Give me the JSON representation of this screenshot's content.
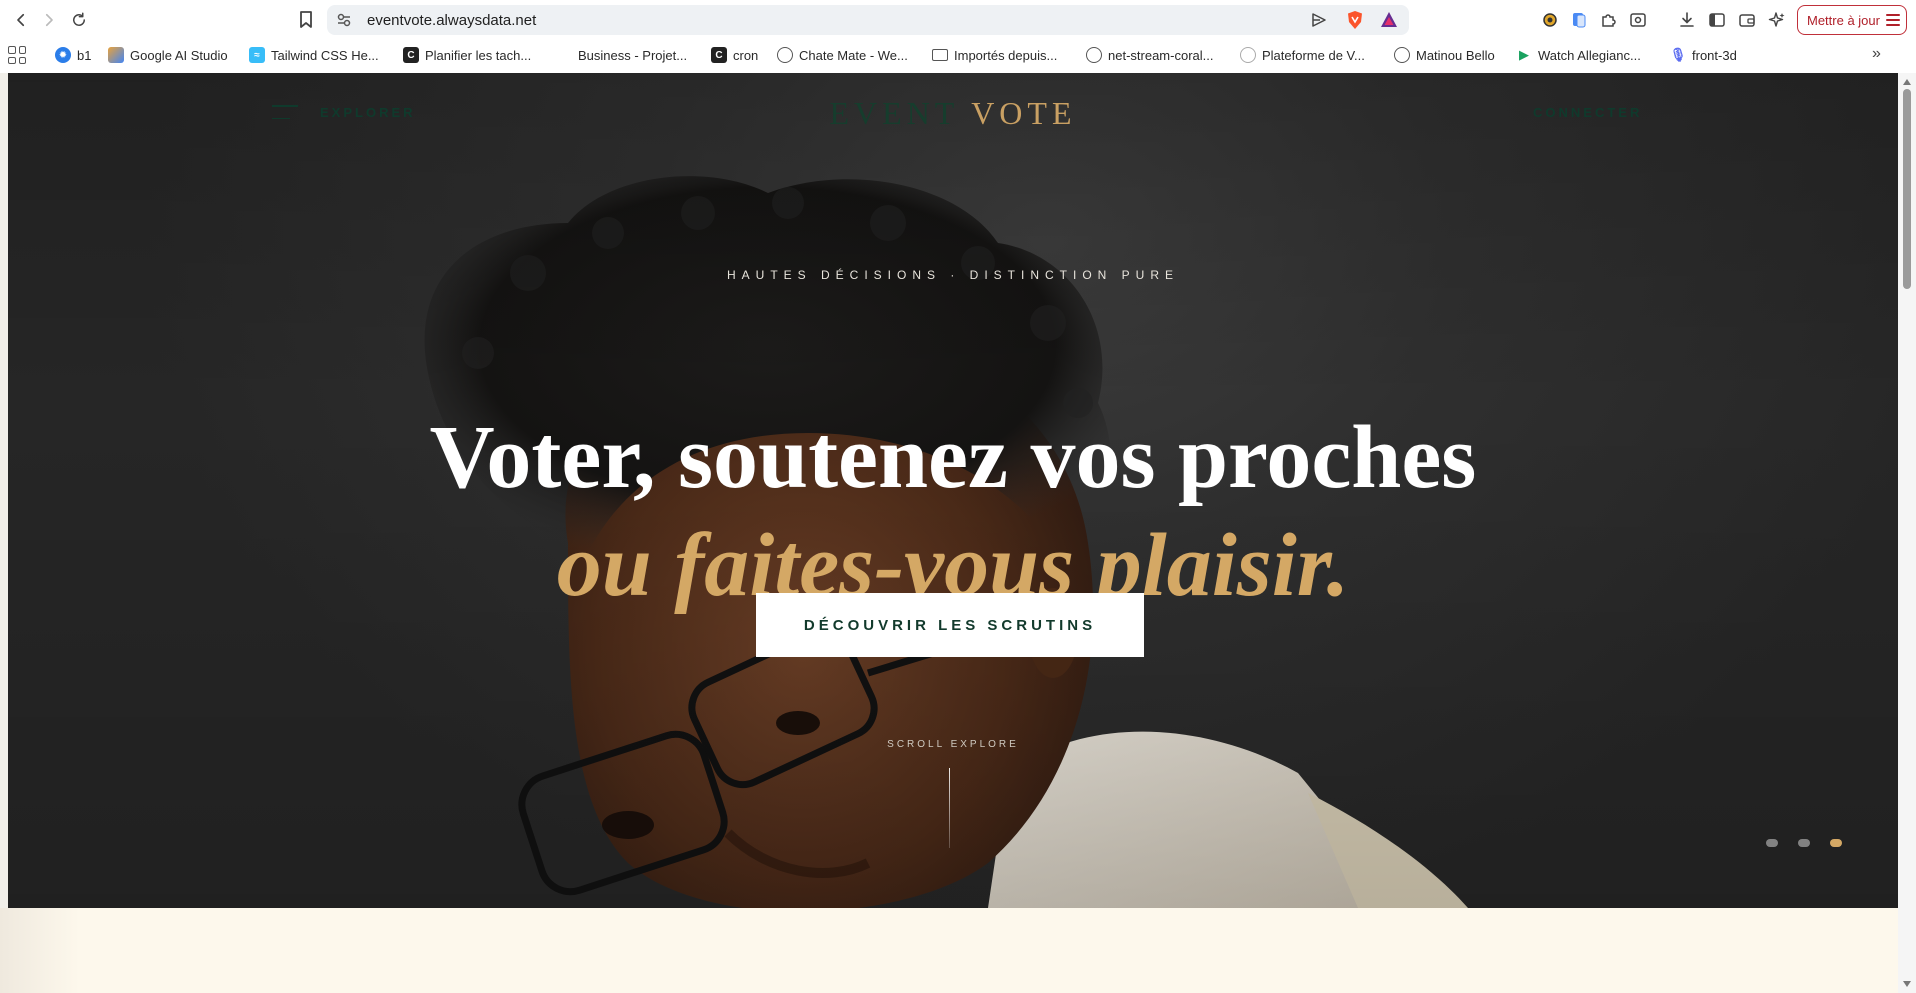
{
  "browser": {
    "url": "eventvote.alwaysdata.net",
    "update_button": "Mettre à jour"
  },
  "bookmarks": [
    {
      "label": "b1",
      "icon": "gear-blue-icon",
      "color": "#2b7de9"
    },
    {
      "label": "Google AI Studio",
      "icon": "ai-studio-icon",
      "color": "#e9a23b"
    },
    {
      "label": "Tailwind CSS He...",
      "icon": "tailwind-icon",
      "color": "#38bdf8"
    },
    {
      "label": "Planifier les tach...",
      "icon": "c-icon",
      "color": "#222222"
    },
    {
      "label": "Business - Projet...",
      "icon": "blank-icon",
      "color": "#ffffff"
    },
    {
      "label": "cron",
      "icon": "c-icon",
      "color": "#222222"
    },
    {
      "label": "Chate Mate - We...",
      "icon": "globe-icon",
      "color": "#555555"
    },
    {
      "label": "Importés depuis...",
      "icon": "folder-icon",
      "color": "#555555"
    },
    {
      "label": "net-stream-coral...",
      "icon": "globe-icon",
      "color": "#555555"
    },
    {
      "label": "Plateforme de V...",
      "icon": "globe-icon",
      "color": "#aaaaaa"
    },
    {
      "label": "Matinou Bello",
      "icon": "globe-icon",
      "color": "#555555"
    },
    {
      "label": "Watch Allegianc...",
      "icon": "play-icon",
      "color": "#1aa260"
    },
    {
      "label": "front-3d",
      "icon": "mic-icon",
      "color": "#5b6cf0"
    }
  ],
  "site": {
    "nav": {
      "explorer": "EXPLORER",
      "logo_part1": "EVENT",
      "logo_part2": "VOTE",
      "connect": "CONNECTER"
    },
    "hero": {
      "eyebrow": "HAUTES DÉCISIONS · DISTINCTION PURE",
      "headline_line1": "Voter, soutenez vos proches",
      "headline_line2": "ou faites-vous plaisir.",
      "cta": "DÉCOUVRIR LES SCRUTINS",
      "scroll_label": "SCROLL EXPLORE",
      "slides": [
        {
          "active": false
        },
        {
          "active": false
        },
        {
          "active": true
        }
      ]
    },
    "colors": {
      "accent_gold": "#d4a865",
      "brand_green": "#163d2d",
      "cream": "#fdf8ec"
    }
  }
}
